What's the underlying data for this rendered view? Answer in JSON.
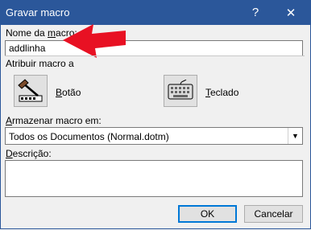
{
  "window": {
    "title": "Gravar macro",
    "help_glyph": "?",
    "close_glyph": "✕"
  },
  "macro_name": {
    "label": "Nome da macro:",
    "value": "addlinha"
  },
  "assign": {
    "label": "Atribuir macro a",
    "button_option": {
      "label": "Botão",
      "icon": "hammer-toolbar-icon"
    },
    "keyboard_option": {
      "label": "Teclado",
      "icon": "keyboard-icon"
    }
  },
  "store_in": {
    "label": "Armazenar macro em:",
    "selected": "Todos os Documentos (Normal.dotm)"
  },
  "description": {
    "label": "Descrição:",
    "value": ""
  },
  "buttons": {
    "ok": "OK",
    "cancel": "Cancelar"
  },
  "colors": {
    "titlebar": "#2b579a",
    "annotation_arrow": "#e81123"
  }
}
